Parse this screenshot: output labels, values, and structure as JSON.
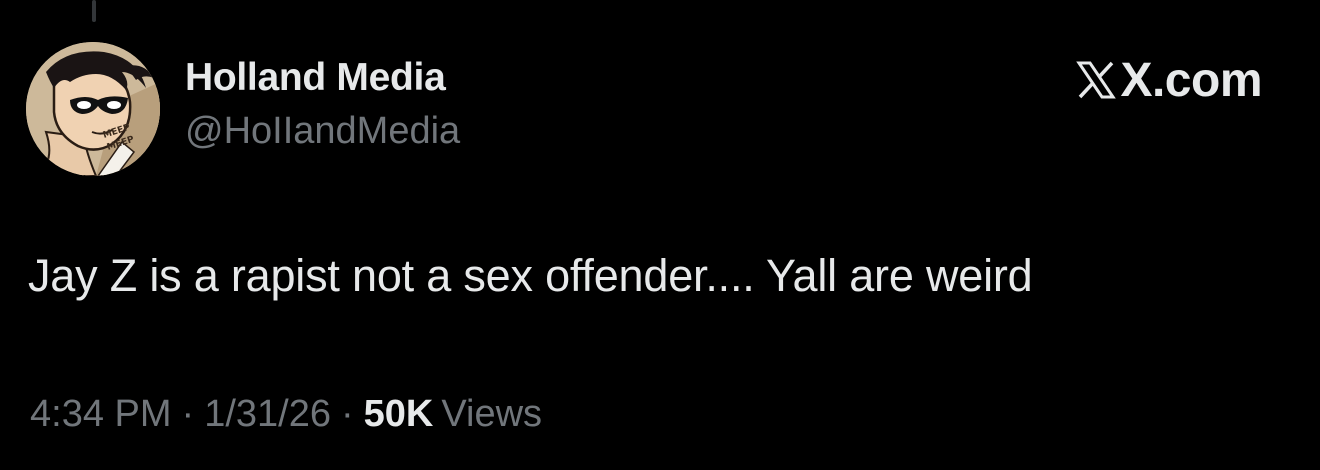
{
  "author": {
    "display_name": "Holland Media",
    "handle": "@HoIIandMedia",
    "avatar_icon": "cartoon-masked-hero-avatar",
    "avatar_text_lines": [
      "MEEP",
      "MEEP"
    ]
  },
  "brand": {
    "icon": "x-logo-icon",
    "label": "X.com"
  },
  "tweet": {
    "text": "Jay Z is a rapist not a sex offender.... Yall are weird"
  },
  "meta": {
    "time": "4:34 PM",
    "separator": "·",
    "date": "1/31/26",
    "views_count": "50K",
    "views_label": "Views"
  },
  "colors": {
    "background": "#000000",
    "primary_text": "#e7e9ea",
    "secondary_text": "#71767b"
  }
}
